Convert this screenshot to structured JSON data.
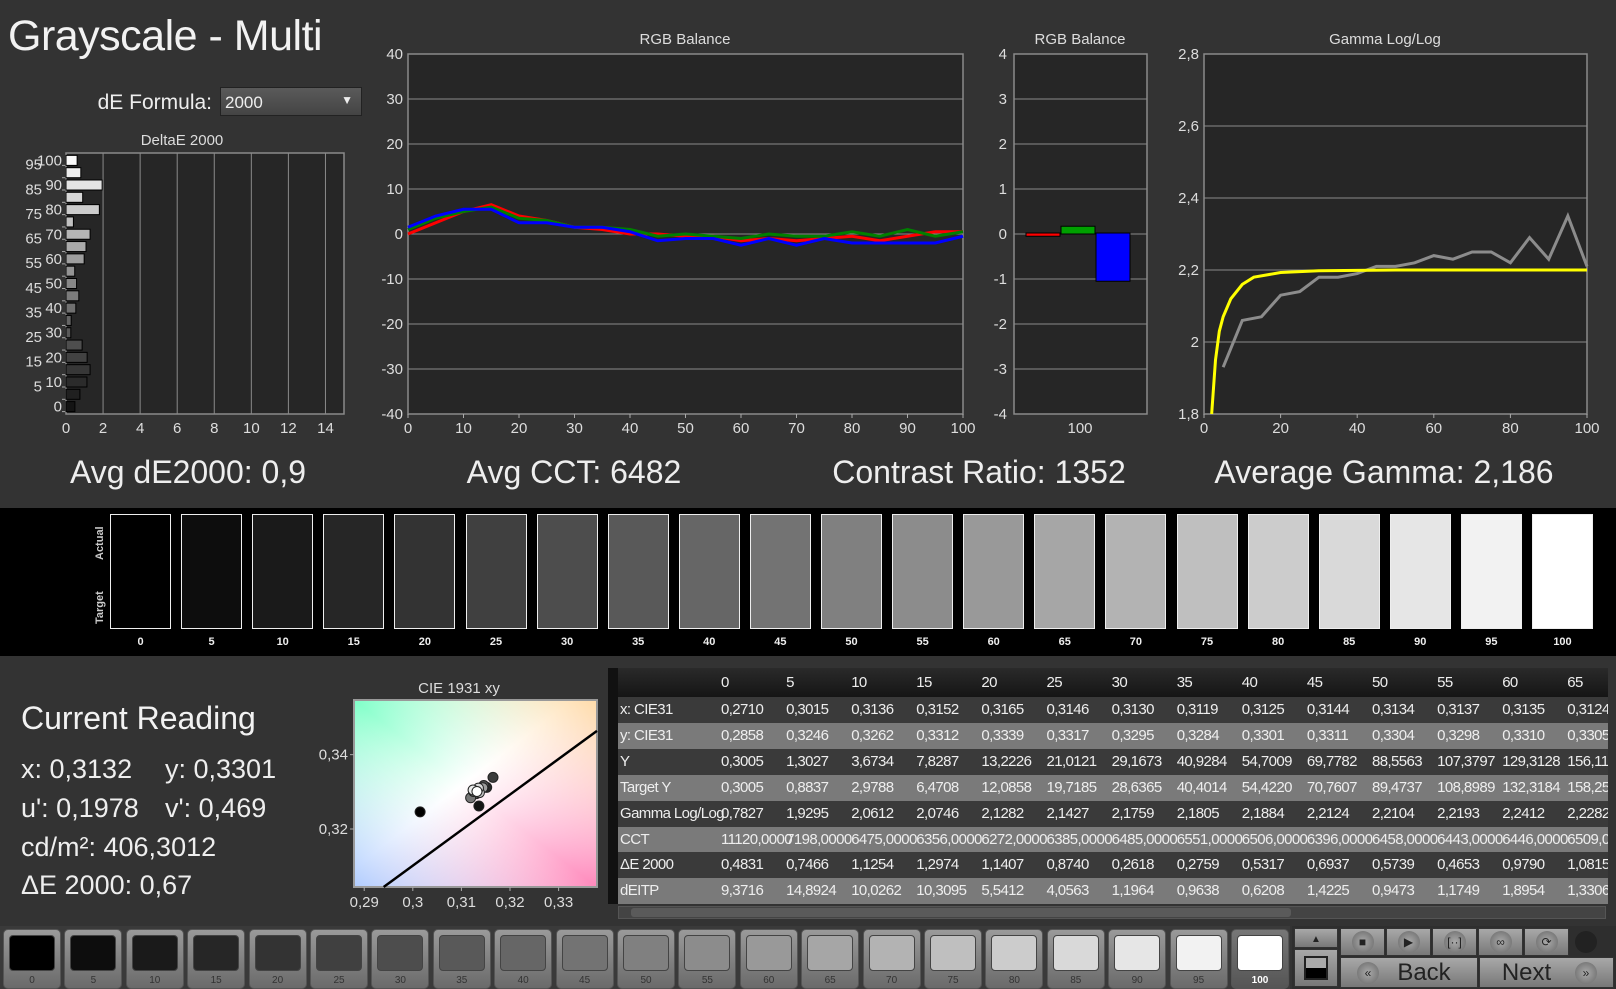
{
  "title": "Grayscale - Multi",
  "de_formula": {
    "label": "dE Formula:",
    "value": "2000"
  },
  "summary": {
    "avg_de": "Avg dE2000: 0,9",
    "avg_cct": "Avg CCT: 6482",
    "contrast": "Contrast Ratio: 1352",
    "avg_gamma": "Average Gamma: 2,186"
  },
  "strip": {
    "actual_label": "Actual",
    "target_label": "Target",
    "levels": [
      "0",
      "5",
      "10",
      "15",
      "20",
      "25",
      "30",
      "35",
      "40",
      "45",
      "50",
      "55",
      "60",
      "65",
      "70",
      "75",
      "80",
      "85",
      "90",
      "95",
      "100"
    ]
  },
  "current_reading": {
    "title": "Current Reading",
    "x": "x: 0,3132",
    "y": "y: 0,3301",
    "u": "u': 0,1978",
    "v": "v': 0,469",
    "lum": "cd/m²: 406,3012",
    "de": "ΔE 2000: 0,67"
  },
  "table": {
    "columns": [
      "0",
      "5",
      "10",
      "15",
      "20",
      "25",
      "30",
      "35",
      "40",
      "45",
      "50",
      "55",
      "60",
      "65"
    ],
    "rows": [
      {
        "label": "x: CIE31",
        "values": [
          "0,2710",
          "0,3015",
          "0,3136",
          "0,3152",
          "0,3165",
          "0,3146",
          "0,3130",
          "0,3119",
          "0,3125",
          "0,3144",
          "0,3134",
          "0,3137",
          "0,3135",
          "0,3124"
        ]
      },
      {
        "label": "y: CIE31",
        "values": [
          "0,2858",
          "0,3246",
          "0,3262",
          "0,3312",
          "0,3339",
          "0,3317",
          "0,3295",
          "0,3284",
          "0,3301",
          "0,3311",
          "0,3304",
          "0,3298",
          "0,3310",
          "0,3305"
        ]
      },
      {
        "label": "Y",
        "values": [
          "0,3005",
          "1,3027",
          "3,6734",
          "7,8287",
          "13,2226",
          "21,0121",
          "29,1673",
          "40,9284",
          "54,7009",
          "69,7782",
          "88,5563",
          "107,3797",
          "129,3128",
          "156,11"
        ]
      },
      {
        "label": "Target Y",
        "values": [
          "0,3005",
          "0,8837",
          "2,9788",
          "6,4708",
          "12,0858",
          "19,7185",
          "28,6365",
          "40,4014",
          "54,4220",
          "70,7607",
          "89,4737",
          "108,8989",
          "132,3184",
          "158,25"
        ]
      },
      {
        "label": "Gamma Log/Log",
        "values": [
          "0,7827",
          "1,9295",
          "2,0612",
          "2,0746",
          "2,1282",
          "2,1427",
          "2,1759",
          "2,1805",
          "2,1884",
          "2,2124",
          "2,2104",
          "2,2193",
          "2,2412",
          "2,2282"
        ]
      },
      {
        "label": "CCT",
        "values": [
          "11120,0000",
          "7198,0000",
          "6475,0000",
          "6356,0000",
          "6272,0000",
          "6385,0000",
          "6485,0000",
          "6551,0000",
          "6506,0000",
          "6396,0000",
          "6458,0000",
          "6443,0000",
          "6446,0000",
          "6509,0"
        ]
      },
      {
        "label": "ΔE 2000",
        "values": [
          "0,4831",
          "0,7466",
          "1,1254",
          "1,2974",
          "1,1407",
          "0,8740",
          "0,2618",
          "0,2759",
          "0,5317",
          "0,6937",
          "0,5739",
          "0,4653",
          "0,9790",
          "1,0815"
        ]
      },
      {
        "label": "dEITP",
        "values": [
          "9,3716",
          "14,8924",
          "10,0262",
          "10,3095",
          "5,5412",
          "4,0563",
          "1,1964",
          "0,9638",
          "0,6208",
          "1,4225",
          "0,9473",
          "1,1749",
          "1,8954",
          "1,3306"
        ]
      }
    ]
  },
  "controls": {
    "back_label": "Back",
    "next_label": "Next",
    "icons": [
      "stop-icon",
      "play-icon",
      "bracket-icon",
      "infinity-icon",
      "refresh-icon"
    ]
  },
  "chart_data": [
    {
      "id": "deltae",
      "type": "bar",
      "orientation": "horizontal",
      "title": "DeltaE 2000",
      "categories": [
        0,
        5,
        10,
        15,
        20,
        25,
        30,
        35,
        40,
        45,
        50,
        55,
        60,
        65,
        70,
        75,
        80,
        85,
        90,
        95,
        100
      ],
      "values": [
        0.48,
        0.75,
        1.13,
        1.3,
        1.14,
        0.87,
        0.26,
        0.28,
        0.53,
        0.69,
        0.57,
        0.47,
        0.98,
        1.08,
        1.3,
        0.4,
        1.8,
        0.9,
        1.95,
        0.8,
        0.6
      ],
      "xlim": [
        0,
        15
      ],
      "x_ticks": [
        "0",
        "2",
        "4",
        "6",
        "8",
        "10",
        "12",
        "14"
      ],
      "y_ticks": [
        "0",
        "5",
        "10",
        "15",
        "20",
        "25",
        "30",
        "35",
        "40",
        "45",
        "50",
        "55",
        "60",
        "65",
        "70",
        "75",
        "80",
        "85",
        "90",
        "95",
        "100"
      ],
      "grid": true
    },
    {
      "id": "rgb-line",
      "type": "line",
      "title": "RGB Balance",
      "x": [
        0,
        5,
        10,
        15,
        20,
        25,
        30,
        35,
        40,
        45,
        50,
        55,
        60,
        65,
        70,
        75,
        80,
        85,
        90,
        95,
        100
      ],
      "series": [
        {
          "color": "#ff0000",
          "values": [
            0,
            2.5,
            5,
            6.5,
            4,
            3,
            1.5,
            1,
            0,
            0,
            -0.5,
            -0.5,
            -1.5,
            -1,
            -1.5,
            -1,
            -0.5,
            -1.5,
            -0.5,
            0.5,
            0.5
          ]
        },
        {
          "color": "#008000",
          "values": [
            1,
            3.5,
            5,
            6,
            3.5,
            3,
            1.5,
            1.5,
            1,
            -0.5,
            0,
            -0.5,
            -1,
            0,
            -0.5,
            -0.5,
            0.5,
            -0.5,
            1,
            -0.5,
            0.5
          ]
        },
        {
          "color": "#0000ff",
          "values": [
            1.5,
            4,
            5.5,
            5.5,
            2.5,
            2.5,
            1.5,
            1.5,
            0.5,
            -1.5,
            -1,
            -1,
            -2.5,
            -1,
            -2.5,
            -1,
            -2,
            -2,
            -2,
            -2,
            -0.5
          ]
        }
      ],
      "xlim": [
        0,
        100
      ],
      "ylim": [
        -40,
        40
      ],
      "x_ticks": [
        "0",
        "10",
        "20",
        "30",
        "40",
        "50",
        "60",
        "70",
        "80",
        "90",
        "100"
      ],
      "y_ticks": [
        "-40",
        "-30",
        "-20",
        "-10",
        "0",
        "10",
        "20",
        "30",
        "40"
      ],
      "grid": true
    },
    {
      "id": "rgb-bar",
      "type": "bar",
      "title": "RGB Balance",
      "categories": [
        "100"
      ],
      "series": [
        {
          "color": "#ff0000",
          "values": [
            -0.05
          ]
        },
        {
          "color": "#00a000",
          "values": [
            0.15
          ]
        },
        {
          "color": "#0000ff",
          "values": [
            -1.05
          ]
        }
      ],
      "ylim": [
        -4,
        4
      ],
      "y_ticks": [
        "-4",
        "-3",
        "-2",
        "-1",
        "0",
        "1",
        "2",
        "3",
        "4"
      ],
      "grid": true
    },
    {
      "id": "gamma",
      "type": "line",
      "title": "Gamma Log/Log",
      "series": [
        {
          "color": "#ffff00",
          "x": [
            2,
            3,
            4,
            5,
            7,
            10,
            13,
            20,
            30,
            50,
            100
          ],
          "values": [
            1.8,
            1.95,
            2.03,
            2.07,
            2.12,
            2.16,
            2.18,
            2.193,
            2.198,
            2.2,
            2.2
          ]
        },
        {
          "color": "#8c8c8c",
          "x": [
            5,
            10,
            15,
            20,
            25,
            30,
            35,
            40,
            45,
            50,
            55,
            60,
            65,
            70,
            75,
            80,
            85,
            90,
            95,
            100
          ],
          "values": [
            1.93,
            2.06,
            2.07,
            2.13,
            2.14,
            2.18,
            2.18,
            2.19,
            2.21,
            2.21,
            2.22,
            2.24,
            2.23,
            2.25,
            2.25,
            2.22,
            2.29,
            2.23,
            2.35,
            2.21
          ]
        }
      ],
      "xlim": [
        0,
        100
      ],
      "ylim": [
        1.8,
        2.8
      ],
      "x_ticks": [
        "0",
        "20",
        "40",
        "60",
        "80",
        "100"
      ],
      "y_ticks": [
        "1,8",
        "2",
        "2,2",
        "2,4",
        "2,6",
        "2,8"
      ],
      "grid": true
    },
    {
      "id": "cie",
      "type": "scatter",
      "title": "CIE 1931 xy",
      "points": [
        [
          0.3015,
          0.3246
        ],
        [
          0.3136,
          0.3262
        ],
        [
          0.3152,
          0.3312
        ],
        [
          0.3165,
          0.3339
        ],
        [
          0.3146,
          0.3317
        ],
        [
          0.313,
          0.3295
        ],
        [
          0.3119,
          0.3284
        ],
        [
          0.3125,
          0.3301
        ],
        [
          0.3144,
          0.3311
        ],
        [
          0.3134,
          0.3304
        ],
        [
          0.3137,
          0.3298
        ],
        [
          0.3135,
          0.331
        ],
        [
          0.3124,
          0.3305
        ],
        [
          0.3132,
          0.3301
        ]
      ],
      "reference_line": [
        [
          0.294,
          0.3044
        ],
        [
          0.3379,
          0.3464
        ]
      ],
      "xlim": [
        0.2879,
        0.3379
      ],
      "ylim": [
        0.3044,
        0.3547
      ],
      "x_ticks": [
        "0,29",
        "0,3",
        "0,31",
        "0,32",
        "0,33"
      ],
      "y_ticks": [
        "0,32",
        "0,34"
      ]
    }
  ]
}
